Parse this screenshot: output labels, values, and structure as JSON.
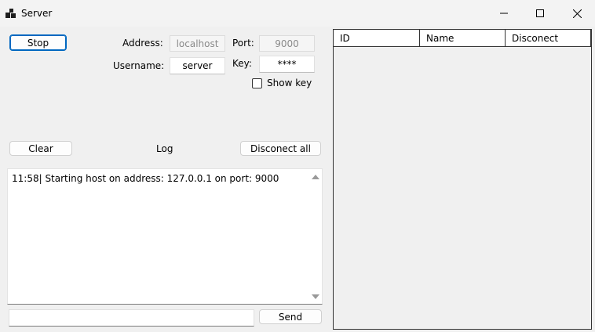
{
  "window": {
    "title": "Server",
    "icon": "app-window-icon",
    "controls": [
      "minimize-icon",
      "maximize-icon",
      "close-icon"
    ]
  },
  "controls": {
    "stop_label": "Stop",
    "address_label": "Address:",
    "address_value": "localhost",
    "port_label": "Port:",
    "port_value": "9000",
    "username_label": "Username:",
    "username_value": "server",
    "key_label": "Key:",
    "key_value": "****",
    "show_key_label": "Show key",
    "show_key_checked": false
  },
  "log": {
    "clear_label": "Clear",
    "title": "Log",
    "disconnect_all_label": "Disconect all",
    "lines": [
      "11:58| Starting host on address: 127.0.0.1 on port: 9000"
    ]
  },
  "send": {
    "input_value": "",
    "send_label": "Send"
  },
  "clients": {
    "columns": [
      "ID",
      "Name",
      "Disconect"
    ],
    "rows": []
  },
  "colors": {
    "accent": "#0067c0",
    "window_bg": "#f0f0f0"
  }
}
